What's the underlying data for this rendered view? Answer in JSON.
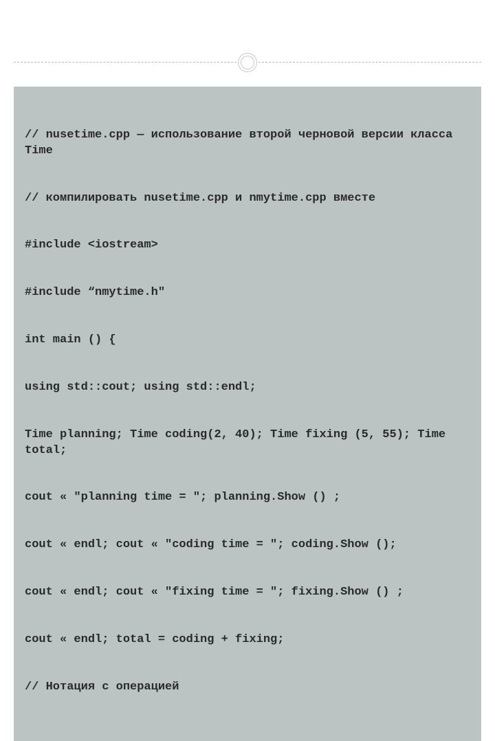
{
  "code": {
    "lines": [
      "// nusetime.cpp — использование второй черновой версии класса Time",
      "// компилировать nusetime.cpp и nmytime.cpp вместе",
      "#include <iostream>",
      "#include “nmytime.h\"",
      "int main () {",
      "using std::cout; using std::endl;",
      "Time planning; Time coding(2, 40); Time fixing (5, 55); Time total;",
      "cout « \"planning time = \"; planning.Show () ;",
      "cout « endl; cout « \"coding time = \"; coding.Show ();",
      "cout « endl; cout « \"fixing time = \"; fixing.Show () ;",
      "cout « endl; total = coding + fixing;",
      "// Нотация с операцией"
    ]
  }
}
